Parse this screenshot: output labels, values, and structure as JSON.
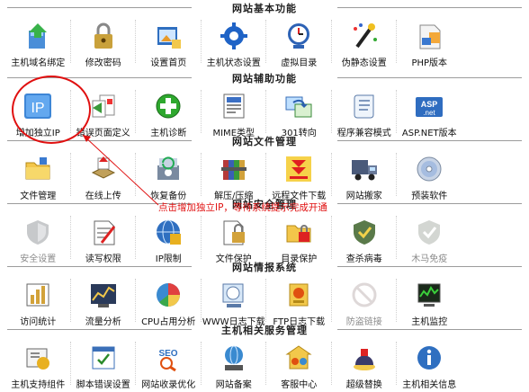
{
  "sections": [
    {
      "title": "网站基本功能",
      "items": [
        {
          "label": "主机域名绑定",
          "icon": "host-domain-icon"
        },
        {
          "label": "修改密码",
          "icon": "lock-key-icon"
        },
        {
          "label": "设置首页",
          "icon": "home-page-icon"
        },
        {
          "label": "主机状态设置",
          "icon": "gear-status-icon"
        },
        {
          "label": "虚拟目录",
          "icon": "virtual-dir-icon"
        },
        {
          "label": "伪静态设置",
          "icon": "magic-wand-icon"
        },
        {
          "label": "PHP版本",
          "icon": "php-doc-icon"
        }
      ]
    },
    {
      "title": "网站辅助功能",
      "items": [
        {
          "label": "增加独立IP",
          "icon": "ip-icon"
        },
        {
          "label": "错误页面定义",
          "icon": "error-page-icon"
        },
        {
          "label": "主机诊断",
          "icon": "plus-circle-icon"
        },
        {
          "label": "MIME类型",
          "icon": "mime-icon"
        },
        {
          "label": "301转向",
          "icon": "redirect-icon"
        },
        {
          "label": "程序兼容模式",
          "icon": "compat-scroll-icon"
        },
        {
          "label": "ASP.NET版本",
          "icon": "aspnet-icon"
        }
      ]
    },
    {
      "title": "网站文件管理",
      "items": [
        {
          "label": "文件管理",
          "icon": "folder-icon"
        },
        {
          "label": "在线上传",
          "icon": "upload-tray-icon"
        },
        {
          "label": "恢复备份",
          "icon": "backup-icon"
        },
        {
          "label": "解压/压缩",
          "icon": "archive-books-icon"
        },
        {
          "label": "远程文件下载",
          "icon": "download-arrow-icon"
        },
        {
          "label": "网站搬家",
          "icon": "truck-icon"
        },
        {
          "label": "预装软件",
          "icon": "cd-disc-icon"
        }
      ]
    },
    {
      "title": "网站安全管理",
      "items": [
        {
          "label": "安全设置",
          "icon": "shield-icon",
          "disabled": true
        },
        {
          "label": "读写权限",
          "icon": "read-write-icon"
        },
        {
          "label": "IP限制",
          "icon": "ip-limit-icon"
        },
        {
          "label": "文件保护",
          "icon": "file-protect-icon"
        },
        {
          "label": "目录保护",
          "icon": "dir-protect-icon"
        },
        {
          "label": "查杀病毒",
          "icon": "antivirus-icon"
        },
        {
          "label": "木马免疫",
          "icon": "trojan-shield-icon",
          "disabled": true
        }
      ]
    },
    {
      "title": "网站情报系统",
      "items": [
        {
          "label": "访问统计",
          "icon": "visit-stats-icon"
        },
        {
          "label": "流量分析",
          "icon": "traffic-chart-icon"
        },
        {
          "label": "CPU占用分析",
          "icon": "cpu-pie-icon"
        },
        {
          "label": "WWW日志下载",
          "icon": "www-log-icon"
        },
        {
          "label": "FTP日志下载",
          "icon": "ftp-log-icon"
        },
        {
          "label": "防盗链接",
          "icon": "anti-leech-icon",
          "disabled": true
        },
        {
          "label": "主机监控",
          "icon": "monitor-icon"
        }
      ]
    },
    {
      "title": "主机相关服务管理",
      "items": [
        {
          "label": "主机支持组件",
          "icon": "components-icon"
        },
        {
          "label": "脚本错误设置",
          "icon": "script-error-icon"
        },
        {
          "label": "网站收录优化",
          "icon": "seo-icon"
        },
        {
          "label": "网站备案",
          "icon": "record-icon"
        },
        {
          "label": "客服中心",
          "icon": "service-center-icon"
        },
        {
          "label": "超级替换",
          "icon": "super-replace-icon"
        },
        {
          "label": "主机相关信息",
          "icon": "host-info-icon"
        }
      ]
    }
  ],
  "annotation": {
    "text": "点击增加独立IP，等待系统提示完成开通",
    "color": "#e01010"
  }
}
